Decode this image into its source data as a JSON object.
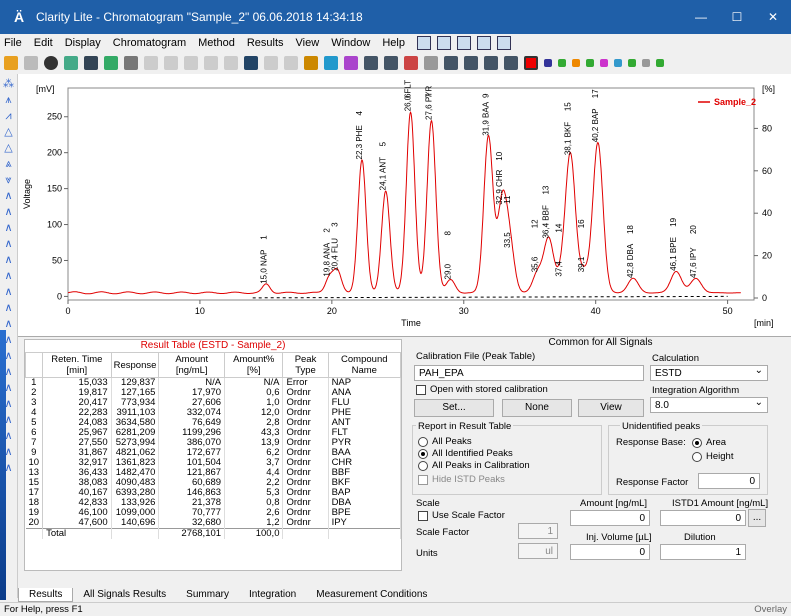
{
  "window": {
    "title": "Clarity Lite - Chromatogram \"Sample_2\" 06.06.2018 14:34:18"
  },
  "menu": [
    "File",
    "Edit",
    "Display",
    "Chromatogram",
    "Method",
    "Results",
    "View",
    "Window",
    "Help"
  ],
  "chart_data": {
    "type": "line",
    "title": "",
    "xlabel": "Time",
    "x_unit": "[min]",
    "ylabel": "Voltage",
    "y_unit": "[mV]",
    "y2_unit": "[%]",
    "xlim": [
      0,
      52
    ],
    "ylim": [
      -5,
      290
    ],
    "x_ticks": [
      0,
      10,
      20,
      30,
      40,
      50
    ],
    "y_ticks": [
      0,
      50,
      100,
      150,
      200,
      250
    ],
    "y2_ticks": [
      0,
      20,
      40,
      60,
      80
    ],
    "legend": "top-right",
    "series": [
      {
        "name": "Sample_2",
        "color": "#e00000"
      }
    ],
    "peaks": [
      {
        "t": 15.033,
        "h": 12,
        "label": "15,0 NAP",
        "n": "1"
      },
      {
        "t": 19.817,
        "h": 22,
        "label": "19,8 ANA",
        "n": "2"
      },
      {
        "t": 20.417,
        "h": 30,
        "label": "20,4 FLU",
        "n": "3"
      },
      {
        "t": 22.283,
        "h": 185,
        "label": "22,3 PHE",
        "n": "4"
      },
      {
        "t": 24.083,
        "h": 142,
        "label": "24,1 ANT",
        "n": "5"
      },
      {
        "t": 25.967,
        "h": 252,
        "label": "26,0 FLT",
        "n": "6"
      },
      {
        "t": 27.55,
        "h": 240,
        "label": "27,6 PYR",
        "n": "7"
      },
      {
        "t": 29.0,
        "h": 18,
        "label": "29,0",
        "n": "8"
      },
      {
        "t": 31.867,
        "h": 218,
        "label": "31,9 BAA",
        "n": "9"
      },
      {
        "t": 32.917,
        "h": 122,
        "label": "32,9 CHR",
        "n": "10"
      },
      {
        "t": 33.5,
        "h": 62,
        "label": "33,5",
        "n": "11"
      },
      {
        "t": 35.6,
        "h": 28,
        "label": "35,6",
        "n": "12"
      },
      {
        "t": 36.433,
        "h": 75,
        "label": "36,4 BBF",
        "n": "13"
      },
      {
        "t": 37.4,
        "h": 22,
        "label": "37,4",
        "n": "14"
      },
      {
        "t": 38.083,
        "h": 191,
        "label": "38,1 BKF",
        "n": "15"
      },
      {
        "t": 39.1,
        "h": 28,
        "label": "39,1",
        "n": "16"
      },
      {
        "t": 40.167,
        "h": 209,
        "label": "40,2 BAP",
        "n": "17"
      },
      {
        "t": 42.833,
        "h": 20,
        "label": "42,8 DBA",
        "n": "18"
      },
      {
        "t": 46.1,
        "h": 30,
        "label": "46,1 BPE",
        "n": "19"
      },
      {
        "t": 47.6,
        "h": 20,
        "label": "47,6 IPY",
        "n": "20"
      }
    ]
  },
  "result_table": {
    "caption": "Result Table (ESTD - Sample_2)",
    "headers": [
      "",
      "Reten. Time [min]",
      "Response",
      "Amount [ng/mL]",
      "Amount% [%]",
      "Peak Type",
      "Compound Name"
    ],
    "rows": [
      [
        "1",
        "15,033",
        "129,837",
        "N/A",
        "N/A",
        "Error",
        "NAP"
      ],
      [
        "2",
        "19,817",
        "127,165",
        "17,970",
        "0,6",
        "Ordnr",
        "ANA"
      ],
      [
        "3",
        "20,417",
        "773,934",
        "27,606",
        "1,0",
        "Ordnr",
        "FLU"
      ],
      [
        "4",
        "22,283",
        "3911,103",
        "332,074",
        "12,0",
        "Ordnr",
        "PHE"
      ],
      [
        "5",
        "24,083",
        "3634,580",
        "76,649",
        "2,8",
        "Ordnr",
        "ANT"
      ],
      [
        "6",
        "25,967",
        "6281,209",
        "1199,296",
        "43,3",
        "Ordnr",
        "FLT"
      ],
      [
        "7",
        "27,550",
        "5273,994",
        "386,070",
        "13,9",
        "Ordnr",
        "PYR"
      ],
      [
        "9",
        "31,867",
        "4821,062",
        "172,677",
        "6,2",
        "Ordnr",
        "BAA"
      ],
      [
        "10",
        "32,917",
        "1361,823",
        "101,504",
        "3,7",
        "Ordnr",
        "CHR"
      ],
      [
        "13",
        "36,433",
        "1482,470",
        "121,867",
        "4,4",
        "Ordnr",
        "BBF"
      ],
      [
        "15",
        "38,083",
        "4090,483",
        "60,689",
        "2,2",
        "Ordnr",
        "BKF"
      ],
      [
        "17",
        "40,167",
        "6393,280",
        "146,863",
        "5,3",
        "Ordnr",
        "BAP"
      ],
      [
        "18",
        "42,833",
        "133,926",
        "21,378",
        "0,8",
        "Ordnr",
        "DBA"
      ],
      [
        "19",
        "46,100",
        "1099,000",
        "70,777",
        "2,6",
        "Ordnr",
        "BPE"
      ],
      [
        "20",
        "47,600",
        "140,696",
        "32,680",
        "1,2",
        "Ordnr",
        "IPY"
      ]
    ],
    "total": [
      "Total",
      "",
      "2768,101",
      "100,0"
    ]
  },
  "common": {
    "header": "Common for All Signals",
    "calib_label": "Calibration File (Peak Table)",
    "calib_value": "PAH_EPA",
    "open_stored": "Open with stored calibration",
    "set_btn": "Set...",
    "none_btn": "None",
    "view_btn": "View",
    "calc_label": "Calculation",
    "calc_value": "ESTD",
    "integ_label": "Integration Algorithm",
    "integ_value": "8.0",
    "report_label": "Report in Result Table",
    "all_peaks": "All Peaks",
    "all_identified": "All Identified Peaks",
    "all_in_calib": "All Peaks in Calibration",
    "hide_istd": "Hide ISTD Peaks",
    "unident_label": "Unidentified peaks",
    "resp_base": "Response Base:",
    "area": "Area",
    "height": "Height",
    "resp_factor": "Response Factor",
    "resp_factor_val": "0",
    "scale_label": "Scale",
    "use_scale": "Use Scale Factor",
    "scale_factor": "Scale Factor",
    "scale_factor_val": "1",
    "units": "Units",
    "units_val": "ul",
    "amount_label": "Amount [ng/mL]",
    "amount_val": "0",
    "istd_label": "ISTD1 Amount [ng/mL]",
    "istd_val": "0",
    "istd_btn": "...",
    "inj_label": "Inj. Volume [µL]",
    "inj_val": "0",
    "dilution_label": "Dilution",
    "dilution_val": "1"
  },
  "tabs": [
    "Results",
    "All Signals Results",
    "Summary",
    "Integration",
    "Measurement Conditions"
  ],
  "status": {
    "help": "For Help, press F1",
    "mode": "Overlay"
  }
}
